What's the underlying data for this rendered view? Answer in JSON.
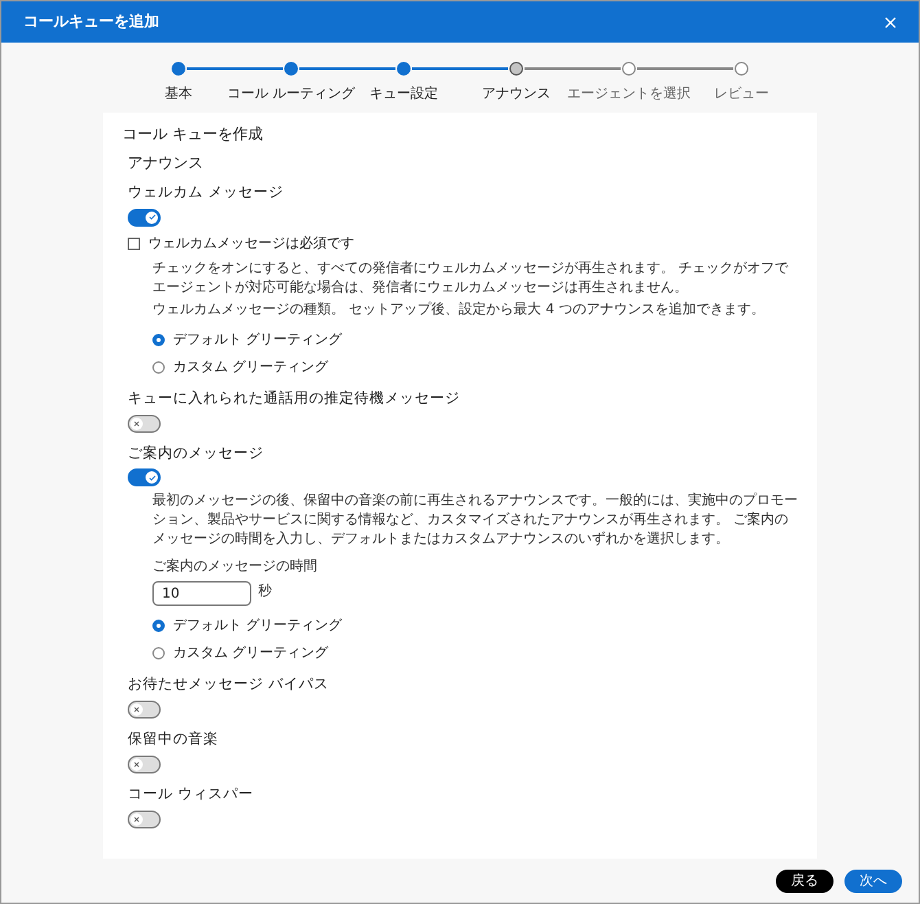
{
  "window": {
    "title": "コールキューを追加"
  },
  "steps": [
    {
      "label": "基本",
      "completed": true,
      "selected": false
    },
    {
      "label": "コール ルーティング",
      "completed": true,
      "selected": false
    },
    {
      "label": "キュー設定",
      "completed": true,
      "selected": false
    },
    {
      "label": "アナウンス",
      "completed": false,
      "selected": true
    },
    {
      "label": "エージェントを選択",
      "completed": false,
      "selected": false
    },
    {
      "label": "レビュー",
      "completed": false,
      "selected": false
    }
  ],
  "form": {
    "heading": "コール キューを作成",
    "subheading": "アナウンス",
    "sections": [
      {
        "label": "ウェルカム メッセージ",
        "on": true,
        "checkbox": {
          "label": "ウェルカムメッセージは必須です",
          "checked": false
        },
        "paragraphs": [
          "チェックをオンにすると、すべての発信者にウェルカムメッセージが再生されます。 チェックがオフでエージェントが対応可能な場合は、発信者にウェルカムメッセージは再生されません。",
          "ウェルカムメッセージの種類。 セットアップ後、設定から最大 4 つのアナウンスを追加できます。"
        ],
        "options": [
          {
            "label": "デフォルト グリーティング",
            "selected": true
          },
          {
            "label": "カスタム グリーティング",
            "selected": false
          }
        ]
      },
      {
        "label": "キューに入れられた通話用の推定待機メッセージ",
        "on": false
      },
      {
        "label": "ご案内のメッセージ",
        "on": true,
        "paragraphs": [
          "最初のメッセージの後、保留中の音楽の前に再生されるアナウンスです。一般的には、実施中のプロモーション、製品やサービスに関する情報など、カスタマイズされたアナウンスが再生されます。 ご案内のメッセージの時間を入力し、デフォルトまたはカスタムアナウンスのいずれかを選択します。"
        ],
        "duration": {
          "label": "ご案内のメッセージの時間",
          "value": "10",
          "unit": "秒"
        },
        "options": [
          {
            "label": "デフォルト グリーティング",
            "selected": true
          },
          {
            "label": "カスタム グリーティング",
            "selected": false
          }
        ]
      },
      {
        "label": "お待たせメッセージ バイパス",
        "on": false
      },
      {
        "label": "保留中の音楽",
        "on": false
      },
      {
        "label": "コール ウィスパー",
        "on": false
      }
    ]
  },
  "buttons": {
    "back": "戻る",
    "next": "次へ"
  }
}
